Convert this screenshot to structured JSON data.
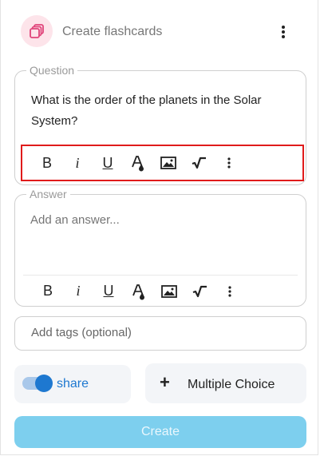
{
  "header": {
    "title": "Create flashcards",
    "icon": "cards-icon",
    "accent_bg": "#fde4ea",
    "accent_icon": "#e0457b"
  },
  "question": {
    "legend": "Question",
    "text": "What is the order of the planets in the Solar System?"
  },
  "answer": {
    "legend": "Answer",
    "placeholder": "Add an answer..."
  },
  "toolbar": {
    "bold": "B",
    "italic": "i",
    "underline": "U"
  },
  "tags": {
    "placeholder": "Add tags (optional)"
  },
  "share": {
    "label": "share",
    "enabled": true,
    "color": "#1e78d0"
  },
  "multiple_choice": {
    "plus": "+",
    "label": "Multiple Choice"
  },
  "create": {
    "label": "Create",
    "color": "#7dcfee"
  },
  "highlight_color": "#e01b1b"
}
